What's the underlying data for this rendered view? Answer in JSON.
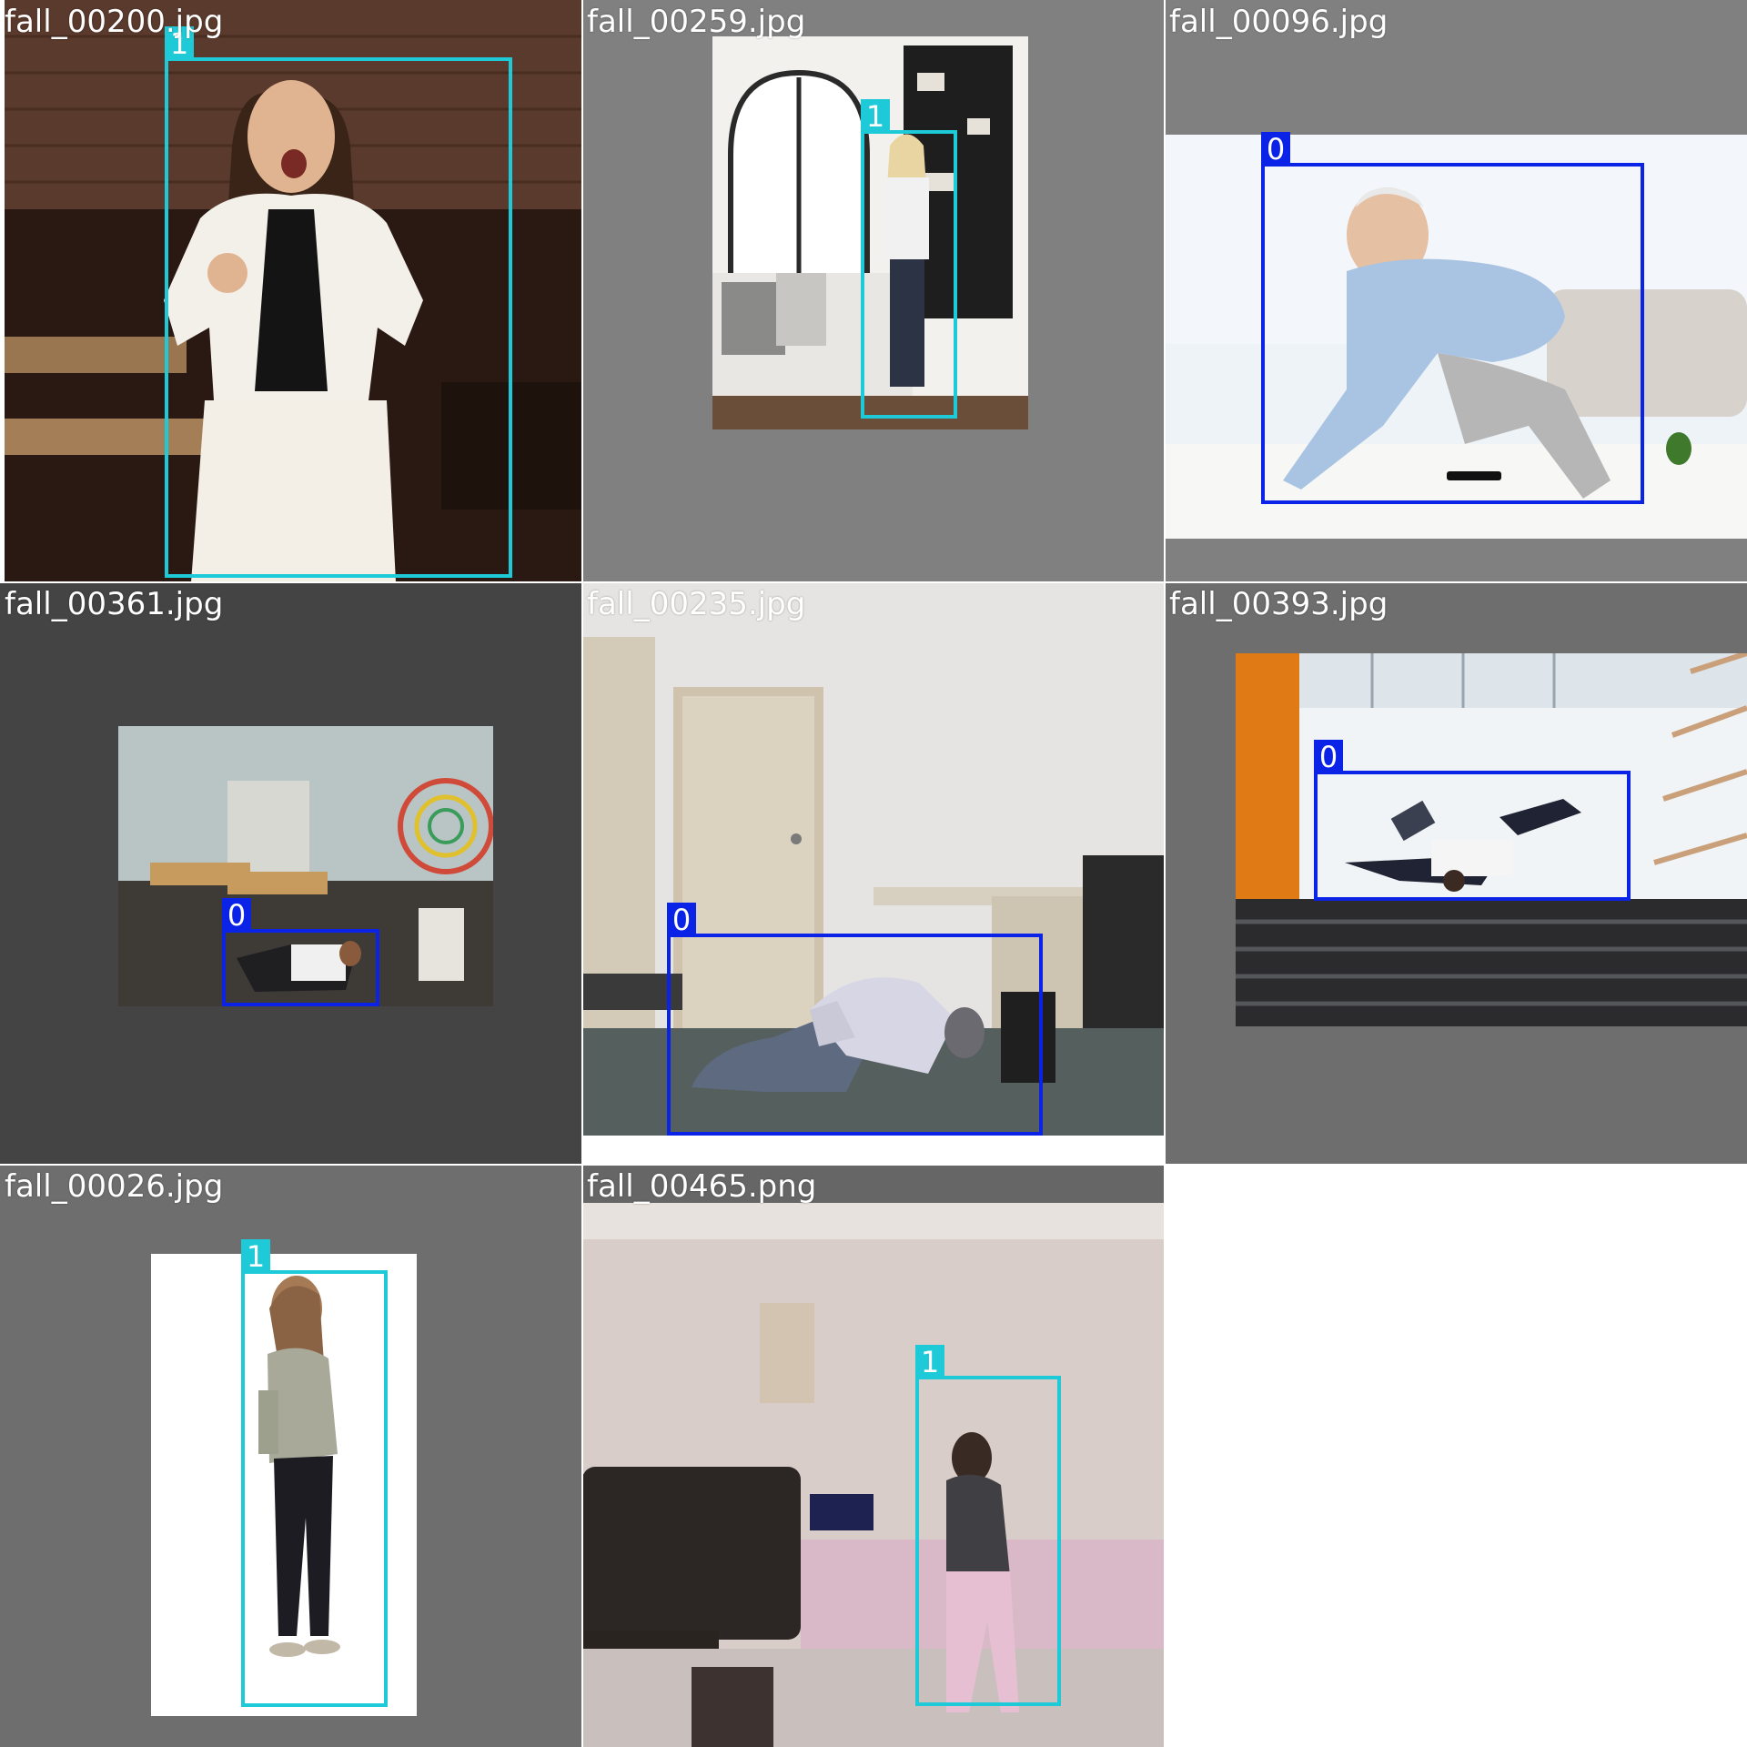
{
  "colors": {
    "class_0": "#0a23e6",
    "class_1": "#1ecad8",
    "filename_text": "#ffffff",
    "pad_gray": "#808080",
    "pad_dark": "#444444",
    "pad_mid": "#6e6e6e",
    "blank": "#ffffff"
  },
  "tiles": [
    {
      "filename": "fall_00200.jpg",
      "label": "1",
      "label_class": 1
    },
    {
      "filename": "fall_00259.jpg",
      "label": "1",
      "label_class": 1
    },
    {
      "filename": "fall_00096.jpg",
      "label": "0",
      "label_class": 0
    },
    {
      "filename": "fall_00361.jpg",
      "label": "0",
      "label_class": 0
    },
    {
      "filename": "fall_00235.jpg",
      "label": "0",
      "label_class": 0
    },
    {
      "filename": "fall_00393.jpg",
      "label": "0",
      "label_class": 0
    },
    {
      "filename": "fall_00026.jpg",
      "label": "1",
      "label_class": 1
    },
    {
      "filename": "fall_00465.png",
      "label": "1",
      "label_class": 1
    }
  ]
}
